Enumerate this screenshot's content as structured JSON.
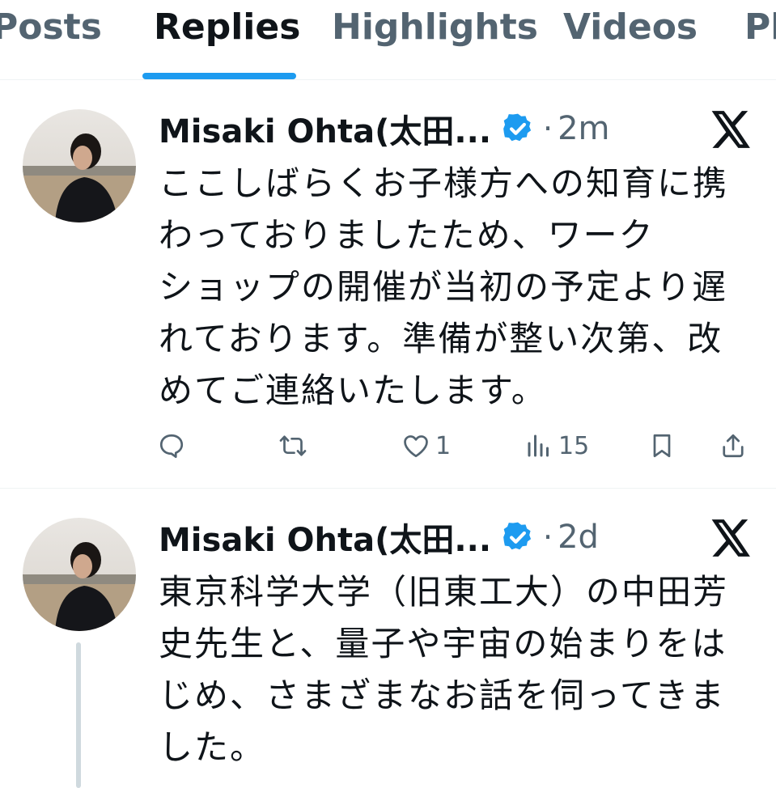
{
  "tabs": [
    {
      "label": "Posts",
      "active": false
    },
    {
      "label": "Replies",
      "active": true
    },
    {
      "label": "Highlights",
      "active": false
    },
    {
      "label": "Videos",
      "active": false
    },
    {
      "label": "Ph",
      "active": false
    }
  ],
  "colors": {
    "accent": "#1d9bf0",
    "text_primary": "#0f1419",
    "text_secondary": "#536471",
    "divider": "#eff3f4",
    "thread_line": "#cfd9de"
  },
  "posts": [
    {
      "author": "Misaki Ohta(太田...",
      "verified": true,
      "separator": "·",
      "time": "2m",
      "lines": [
        "ここしばらくお子様方への知育に携",
        "わっておりましたため、ワーク",
        "ショップの開催が当初の予定より遅",
        "れております。準備が整い次第、改",
        "めてご連絡いたします。"
      ],
      "actions": {
        "reply_icon": "reply-icon",
        "repost_icon": "repost-icon",
        "like_icon": "heart-icon",
        "like_count": "1",
        "views_icon": "views-icon",
        "views_count": "15",
        "bookmark_icon": "bookmark-icon",
        "share_icon": "share-icon"
      }
    },
    {
      "author": "Misaki Ohta(太田...",
      "verified": true,
      "separator": "·",
      "time": "2d",
      "lines": [
        "東京科学大学（旧東工大）の中田芳",
        "史先生と、量子や宇宙の始まりをは",
        "じめ、さまざまなお話を伺ってきま",
        "した。"
      ]
    }
  ]
}
